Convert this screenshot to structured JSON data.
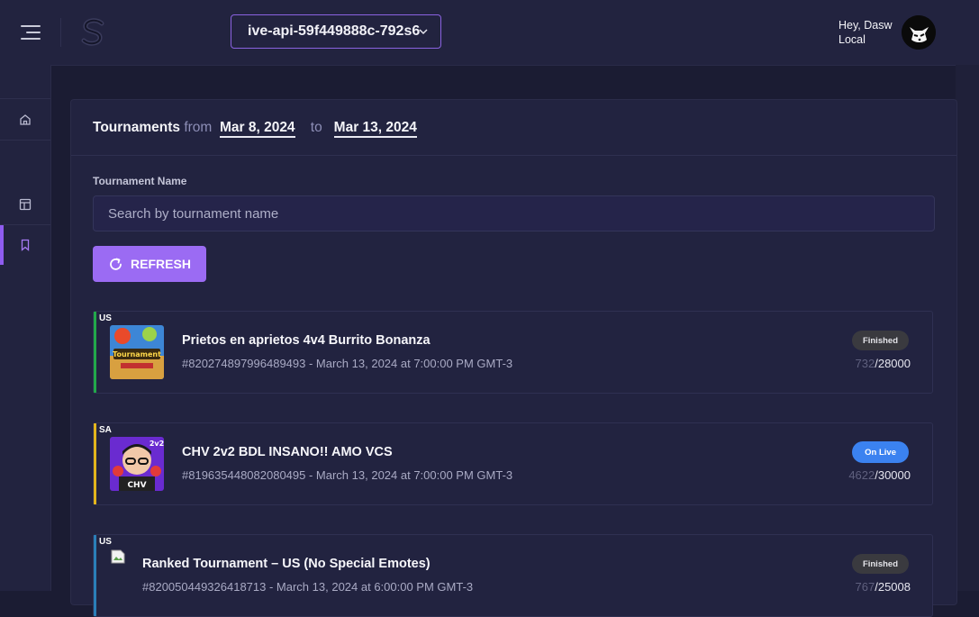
{
  "header": {
    "environment": "ive-api-59f449888c-792s6",
    "greeting": "Hey, Dasw",
    "subtitle": "Local"
  },
  "sidebar": {
    "items": [
      {
        "icon": "home-icon"
      },
      {
        "icon": "layout-icon"
      },
      {
        "icon": "bookmark-icon",
        "active": true
      }
    ]
  },
  "page": {
    "title": "Tournaments",
    "from_label": "from",
    "from_date": "Mar 8, 2024",
    "to_label": "to",
    "to_date": "Mar 13, 2024",
    "field_label": "Tournament Name",
    "search_placeholder": "Search by tournament name",
    "refresh_label": "REFRESH"
  },
  "tournaments": [
    {
      "region": "US",
      "name": "Prietos en aprietos 4v4 Burrito Bonanza",
      "meta": "#820274897996489493 - March 13, 2024 at 7:00:00 PM GMT-3",
      "status": "Finished",
      "current": "732",
      "max": "/28000",
      "accent": "#22a84a"
    },
    {
      "region": "SA",
      "name": "CHV 2v2 BDL INSANO!! AMO VCS",
      "meta": "#819635448082080495 - March 13, 2024 at 7:00:00 PM GMT-3",
      "status": "On Live",
      "current": "4622",
      "max": "/30000",
      "accent": "#e2b41c"
    },
    {
      "region": "US",
      "name": "Ranked Tournament – US (No Special Emotes)",
      "meta": "#820050449326418713 - March 13, 2024 at 6:00:00 PM GMT-3",
      "status": "Finished",
      "current": "767",
      "max": "/25008",
      "accent": "#2a7fb8"
    }
  ],
  "colors": {
    "primary": "#9b6bf3",
    "live": "#3b82f0",
    "background": "#1b1c33"
  }
}
